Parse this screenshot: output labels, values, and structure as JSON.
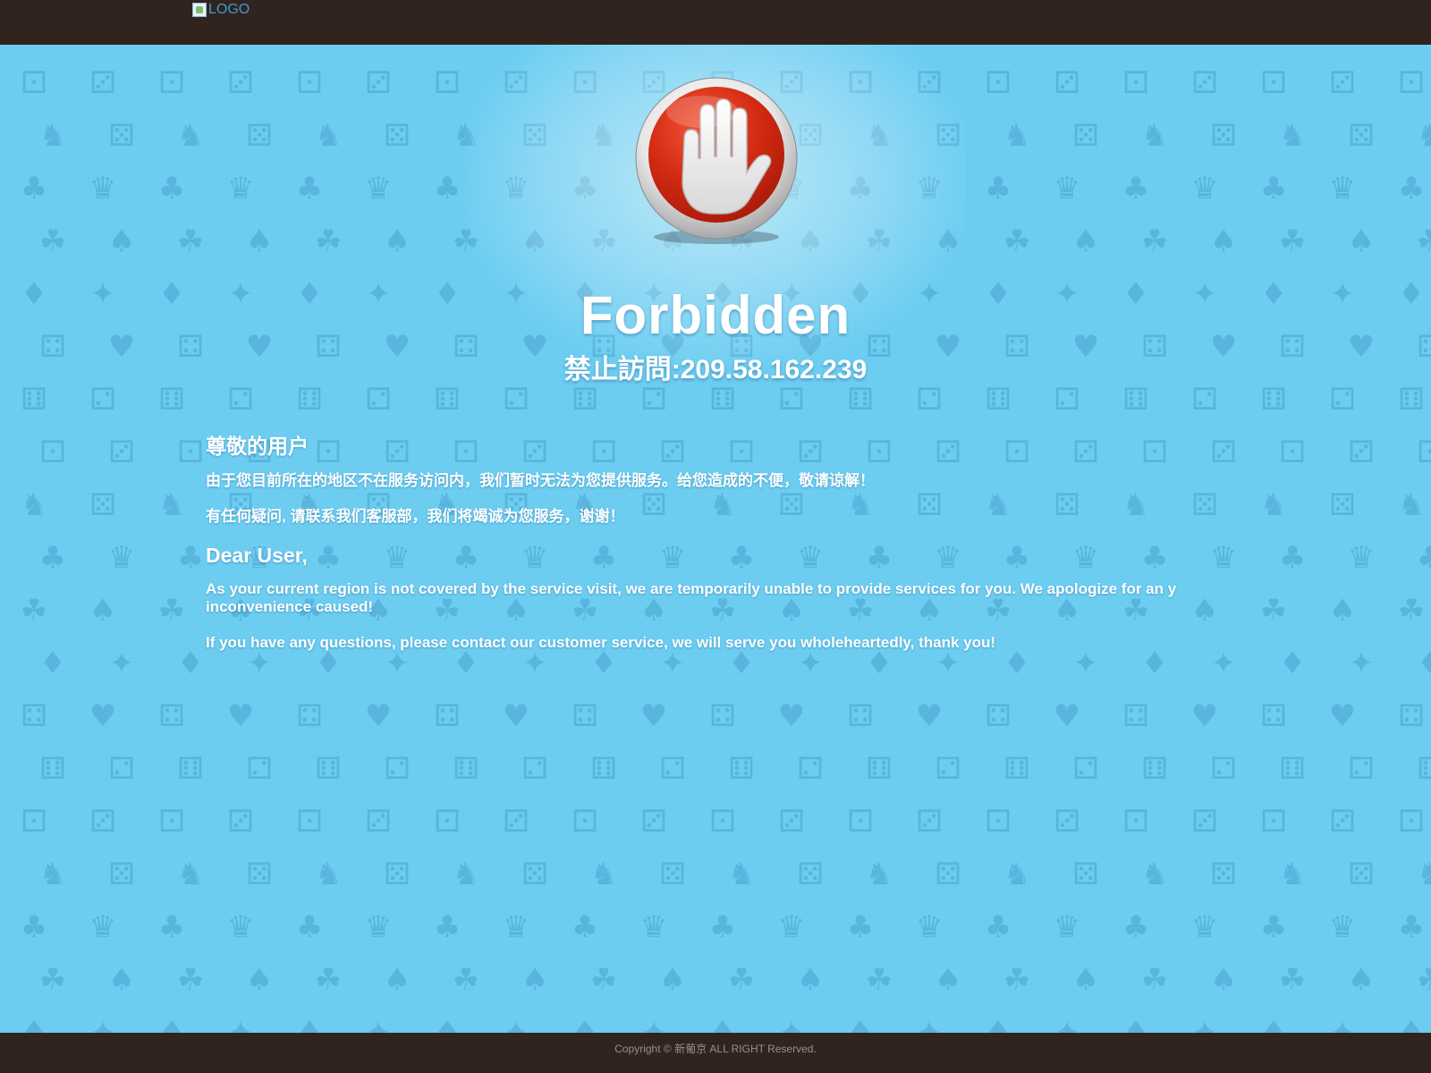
{
  "header": {
    "logo_alt": "LOGO"
  },
  "hero": {
    "icon": "stop-hand-icon",
    "title": "Forbidden",
    "subtitle": "禁止訪問:209.58.162.239"
  },
  "message_zh": {
    "greeting": "尊敬的用户",
    "line1": "由于您目前所在的地区不在服务访问内，我们暂时无法为您提供服务。给您造成的不便，敬请谅解！",
    "line2": "有任何疑问, 请联系我们客服部，我们将竭诚为您服务，谢谢！"
  },
  "message_en": {
    "greeting": "Dear User,",
    "line1": "As your current region is not covered by the service visit, we are temporarily unable to provide services for you. We apologize for an y inconvenience caused!",
    "line2": "If you have any questions, please contact our customer service, we will serve you wholeheartedly, thank you!"
  },
  "footer": {
    "copyright": "Copyright © 新葡京 ALL RIGHT Reserved."
  },
  "colors": {
    "topbar": "#31231e",
    "background": "#6ccdf1",
    "text": "#ffffff",
    "stop_red": "#d9301a"
  }
}
